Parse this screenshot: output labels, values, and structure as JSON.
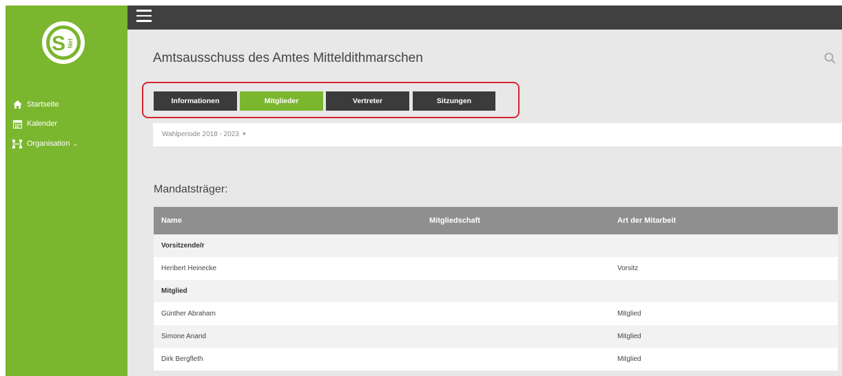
{
  "sidebar": {
    "logo_text": "S Net",
    "items": [
      {
        "label": "Startseite",
        "icon": "home-icon"
      },
      {
        "label": "Kalender",
        "icon": "calendar-icon"
      },
      {
        "label": "Organisation",
        "icon": "organisation-icon",
        "suffix": "⌄"
      }
    ]
  },
  "header": {
    "title": "Amtsausschuss des Amtes Mitteldithmarschen",
    "search_icon": "search-icon"
  },
  "tabs": [
    {
      "label": "Informationen",
      "active": false
    },
    {
      "label": "Mitglieder",
      "active": true
    },
    {
      "label": "Vertreter",
      "active": false
    },
    {
      "label": "Sitzungen",
      "active": false
    }
  ],
  "period": {
    "label": "Wahlperiode 2018 - 2023",
    "caret": "▼"
  },
  "section": {
    "heading": "Mandatsträger:"
  },
  "table": {
    "columns": [
      "Name",
      "Mitgliedschaft",
      "Art der Mitarbeit"
    ],
    "rows": [
      {
        "type": "group",
        "name": "Vorsitzende/r",
        "membership": "",
        "role": ""
      },
      {
        "type": "member",
        "name": "Heribert Heinecke",
        "membership": "",
        "role": "Vorsitz"
      },
      {
        "type": "group",
        "name": "Mitglied",
        "membership": "",
        "role": ""
      },
      {
        "type": "member",
        "name": "Günther Abraham",
        "membership": "",
        "role": "Mitglied"
      },
      {
        "type": "member",
        "name": "Simone Anand",
        "membership": "",
        "role": "Mitglied"
      },
      {
        "type": "member",
        "name": "Dirk Bergfleth",
        "membership": "",
        "role": "Mitglied"
      }
    ]
  },
  "colors": {
    "brand_green": "#7bb62f",
    "topbar": "#404040",
    "tab_dark": "#3b3b3b",
    "table_header": "#8f8f8f",
    "highlight_red": "#d7232e"
  }
}
